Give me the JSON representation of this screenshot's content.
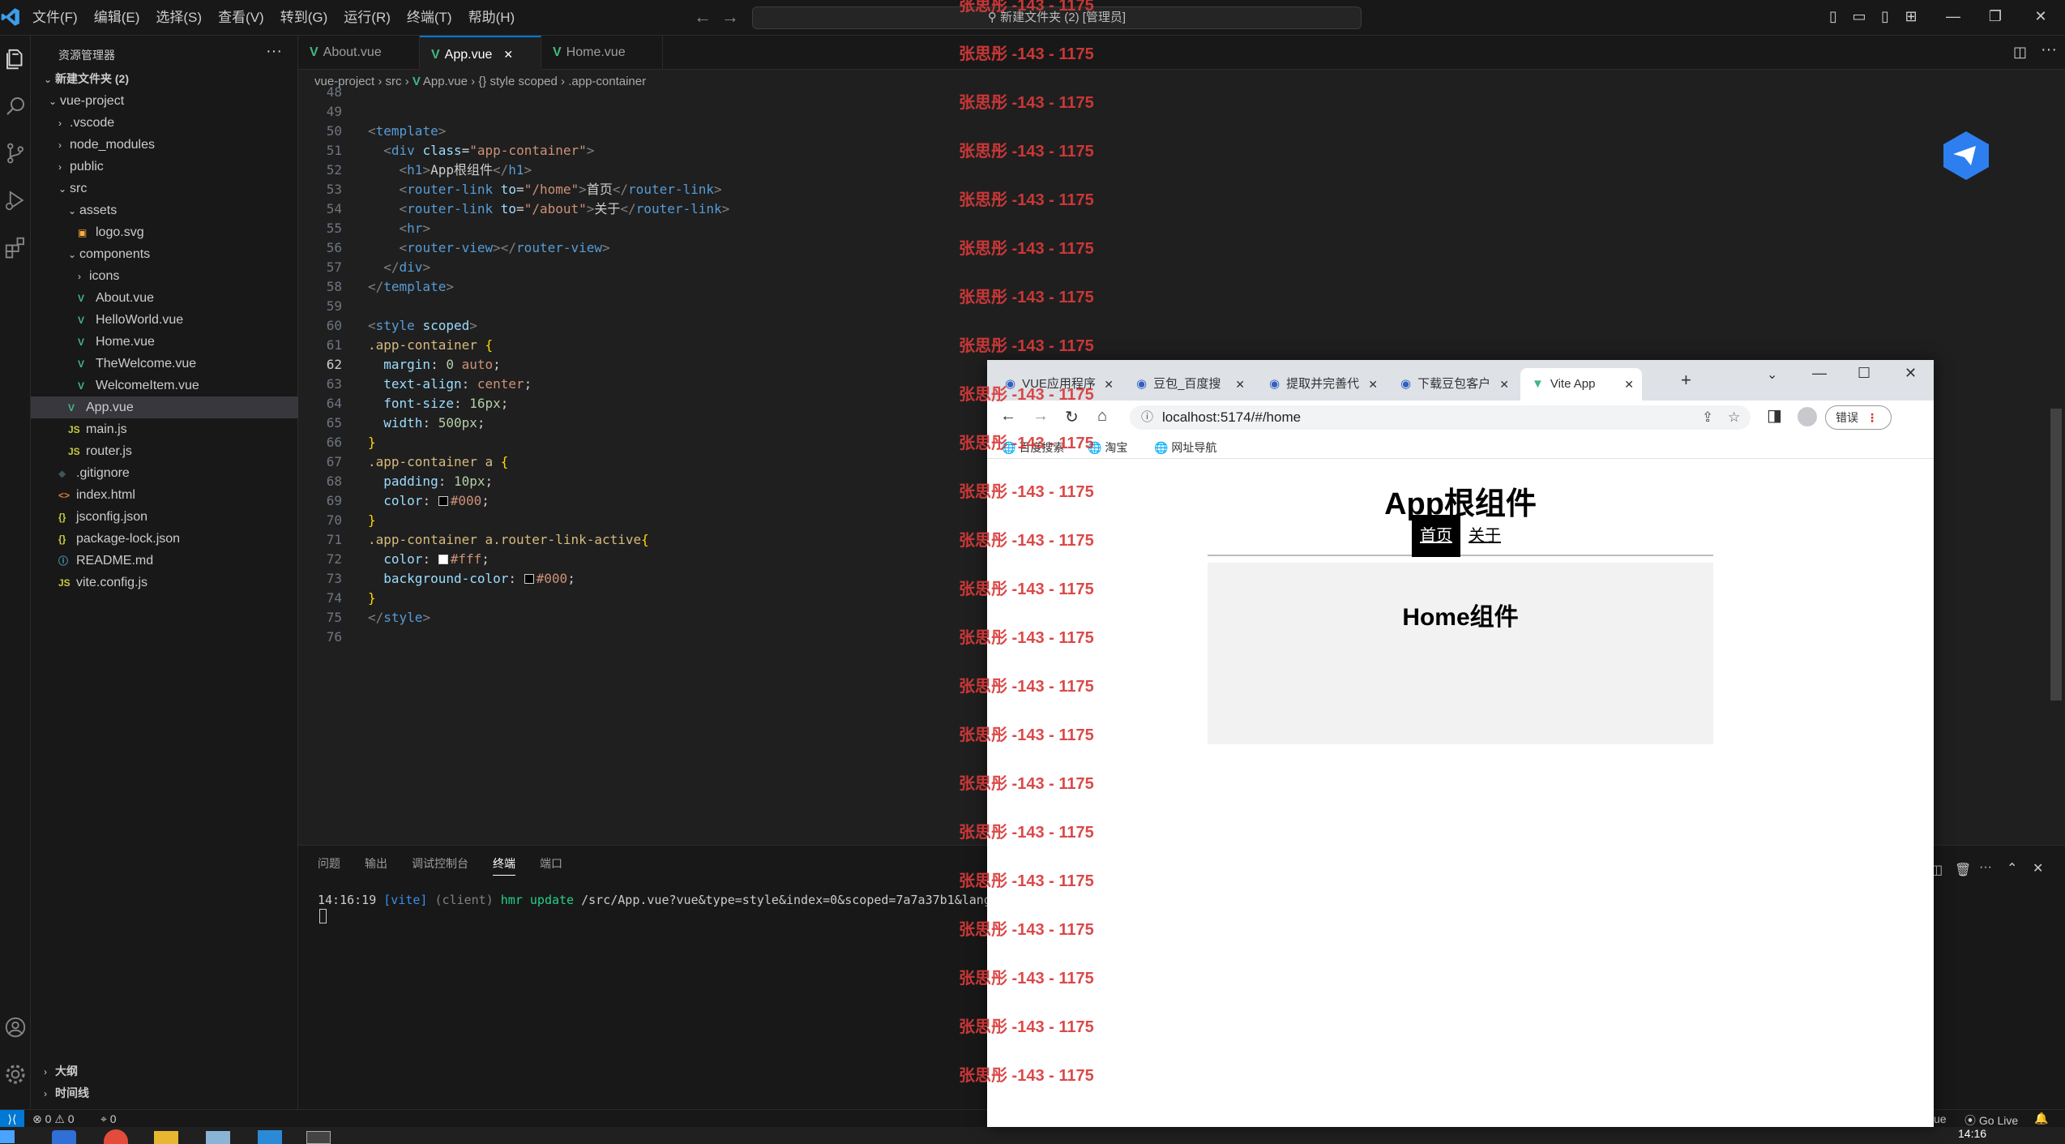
{
  "menubar": [
    "文件(F)",
    "编辑(E)",
    "选择(S)",
    "查看(V)",
    "转到(G)",
    "运行(R)",
    "终端(T)",
    "帮助(H)"
  ],
  "search_box": "新建文件夹 (2) [管理员]",
  "explorer": {
    "title": "资源管理器",
    "root": "新建文件夹 (2)",
    "items": [
      {
        "label": "vue-project",
        "kind": "folder-open",
        "level": 1
      },
      {
        "label": ".vscode",
        "kind": "folder",
        "level": 2
      },
      {
        "label": "node_modules",
        "kind": "folder",
        "level": 2
      },
      {
        "label": "public",
        "kind": "folder",
        "level": 2
      },
      {
        "label": "src",
        "kind": "folder-open",
        "level": 2
      },
      {
        "label": "assets",
        "kind": "folder-open",
        "level": 3
      },
      {
        "label": "logo.svg",
        "kind": "svg",
        "level": 4
      },
      {
        "label": "components",
        "kind": "folder-open",
        "level": 3
      },
      {
        "label": "icons",
        "kind": "folder",
        "level": 4
      },
      {
        "label": "About.vue",
        "kind": "vue",
        "level": 4
      },
      {
        "label": "HelloWorld.vue",
        "kind": "vue",
        "level": 4
      },
      {
        "label": "Home.vue",
        "kind": "vue",
        "level": 4
      },
      {
        "label": "TheWelcome.vue",
        "kind": "vue",
        "level": 4
      },
      {
        "label": "WelcomeItem.vue",
        "kind": "vue",
        "level": 4
      },
      {
        "label": "App.vue",
        "kind": "vue",
        "level": 3,
        "selected": true
      },
      {
        "label": "main.js",
        "kind": "js",
        "level": 3
      },
      {
        "label": "router.js",
        "kind": "js",
        "level": 3
      },
      {
        "label": ".gitignore",
        "kind": "git",
        "level": 2
      },
      {
        "label": "index.html",
        "kind": "html",
        "level": 2
      },
      {
        "label": "jsconfig.json",
        "kind": "json",
        "level": 2
      },
      {
        "label": "package-lock.json",
        "kind": "json",
        "level": 2
      },
      {
        "label": "README.md",
        "kind": "md",
        "level": 2
      },
      {
        "label": "vite.config.js",
        "kind": "js",
        "level": 2
      }
    ],
    "outline": "大纲",
    "timeline": "时间线"
  },
  "editor": {
    "tabs": [
      "About.vue",
      "App.vue",
      "Home.vue"
    ],
    "active_tab": 1,
    "breadcrumb": [
      "vue-project",
      "src",
      "App.vue",
      "{} style scoped",
      ".app-container"
    ],
    "lines": [
      {
        "n": "48",
        "html": ""
      },
      {
        "n": "49",
        "html": ""
      },
      {
        "n": "50",
        "html": "<span class='tag'>&lt;</span><span class='tn'>template</span><span class='tag'>&gt;</span>"
      },
      {
        "n": "51",
        "html": "  <span class='tag'>&lt;</span><span class='tn'>div</span> <span class='at'>class</span>=<span class='st'>\"app-container\"</span><span class='tag'>&gt;</span>"
      },
      {
        "n": "52",
        "html": "    <span class='tag'>&lt;</span><span class='tn'>h1</span><span class='tag'>&gt;</span>App根组件<span class='tag'>&lt;/</span><span class='tn'>h1</span><span class='tag'>&gt;</span>"
      },
      {
        "n": "53",
        "html": "    <span class='tag'>&lt;</span><span class='tn'>router-link</span> <span class='at'>to</span>=<span class='st'>\"/home\"</span><span class='tag'>&gt;</span>首页<span class='tag'>&lt;/</span><span class='tn'>router-link</span><span class='tag'>&gt;</span>"
      },
      {
        "n": "54",
        "html": "    <span class='tag'>&lt;</span><span class='tn'>router-link</span> <span class='at'>to</span>=<span class='st'>\"/about\"</span><span class='tag'>&gt;</span>关于<span class='tag'>&lt;/</span><span class='tn'>router-link</span><span class='tag'>&gt;</span>"
      },
      {
        "n": "55",
        "html": "    <span class='tag'>&lt;</span><span class='tn'>hr</span><span class='tag'>&gt;</span>"
      },
      {
        "n": "56",
        "html": "    <span class='tag'>&lt;</span><span class='tn'>router-view</span><span class='tag'>&gt;&lt;/</span><span class='tn'>router-view</span><span class='tag'>&gt;</span>"
      },
      {
        "n": "57",
        "html": "  <span class='tag'>&lt;/</span><span class='tn'>div</span><span class='tag'>&gt;</span>"
      },
      {
        "n": "58",
        "html": "<span class='tag'>&lt;/</span><span class='tn'>template</span><span class='tag'>&gt;</span>"
      },
      {
        "n": "59",
        "html": ""
      },
      {
        "n": "60",
        "html": "<span class='tag'>&lt;</span><span class='tn'>style</span> <span class='at'>scoped</span><span class='tag'>&gt;</span>"
      },
      {
        "n": "61",
        "html": "<span class='sel'>.app-container</span> <span class='br'>{</span>"
      },
      {
        "n": "62",
        "html": "  <span class='pr'>margin</span>: <span class='nu'>0</span> <span class='st'>auto</span>;"
      },
      {
        "n": "63",
        "html": "  <span class='pr'>text-align</span>: <span class='st'>center</span>;"
      },
      {
        "n": "64",
        "html": "  <span class='pr'>font-size</span>: <span class='nu'>16px</span>;"
      },
      {
        "n": "65",
        "html": "  <span class='pr'>width</span>: <span class='nu'>500px</span>;"
      },
      {
        "n": "66",
        "html": "<span class='br'>}</span>"
      },
      {
        "n": "67",
        "html": "<span class='sel'>.app-container a</span> <span class='br'>{</span>"
      },
      {
        "n": "68",
        "html": "  <span class='pr'>padding</span>: <span class='nu'>10px</span>;"
      },
      {
        "n": "69",
        "html": "  <span class='pr'>color</span>: <span class='sw' style='background:#000'></span><span class='st'>#000</span>;"
      },
      {
        "n": "70",
        "html": "<span class='br'>}</span>"
      },
      {
        "n": "71",
        "html": "<span class='sel'>.app-container a.router-link-active</span><span class='br'>{</span>"
      },
      {
        "n": "72",
        "html": "  <span class='pr'>color</span>: <span class='sw' style='background:#fff'></span><span class='st'>#fff</span>;"
      },
      {
        "n": "73",
        "html": "  <span class='pr'>background-color</span>: <span class='sw' style='background:#000'></span><span class='st'>#000</span>;"
      },
      {
        "n": "74",
        "html": "<span class='br'>}</span>"
      },
      {
        "n": "75",
        "html": "<span class='tag'>&lt;/</span><span class='tn'>style</span><span class='tag'>&gt;</span>"
      },
      {
        "n": "76",
        "html": ""
      }
    ]
  },
  "panel": {
    "tabs": [
      "问题",
      "输出",
      "调试控制台",
      "终端",
      "端口"
    ],
    "active_tab": 3,
    "terminal_time": "14:16:19",
    "terminal_tag": "[vite]",
    "terminal_client": "(client)",
    "terminal_msg": "hmr update",
    "terminal_path": "/src/App.vue?vue&type=style&index=0&scoped=7a7a37b1&lang"
  },
  "statusbar": {
    "errors": "0",
    "warnings": "0",
    "ports": "0",
    "golive": "Go Live",
    "lang_tail": "ue"
  },
  "taskbar": {
    "time": "14:16"
  },
  "browser": {
    "tabs": [
      "VUE应用程序",
      "豆包_百度搜",
      "提取并完善代",
      "下载豆包客户",
      "Vite App"
    ],
    "active_tab": 4,
    "url": "localhost:5174/#/home",
    "error_btn": "错误",
    "bookmarks": [
      "百度搜索",
      "淘宝",
      "网址导航"
    ],
    "page": {
      "h1": "App根组件",
      "links": [
        "首页",
        "关于"
      ],
      "active_link": 0,
      "view_heading": "Home组件"
    }
  },
  "watermark": {
    "text": "张思彤 -143 - 1175",
    "count": 23
  },
  "colors": {
    "accent": "#0078d4",
    "vue": "#41b883",
    "watermark": "#d93a3a"
  }
}
